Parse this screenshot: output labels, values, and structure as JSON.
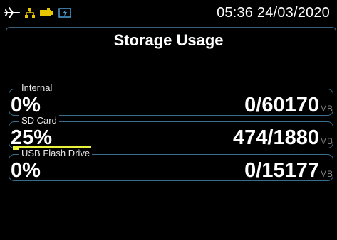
{
  "status_bar": {
    "icons": [
      "airplane-icon",
      "network-icon",
      "battery-icon",
      "charging-icon"
    ],
    "time": "05:36",
    "date": "24/03/2020"
  },
  "page": {
    "title": "Storage Usage"
  },
  "storage": [
    {
      "label": "Internal",
      "percent_text": "0%",
      "used_total": "0/60170",
      "unit": "MB",
      "usage_fraction": 0.0
    },
    {
      "label": "SD Card",
      "percent_text": "25%",
      "used_total": "474/1880",
      "unit": "MB",
      "usage_fraction": 0.25
    },
    {
      "label": "USB Flash Drive",
      "percent_text": "0%",
      "used_total": "0/15177",
      "unit": "MB",
      "usage_fraction": 0.0
    }
  ],
  "colors": {
    "background": "#000000",
    "text": "#ffffff",
    "border": "#3a6e8e",
    "progress": "#e8f23c",
    "icon_yellow": "#e6c600",
    "icon_charge": "#4a9fd6"
  }
}
